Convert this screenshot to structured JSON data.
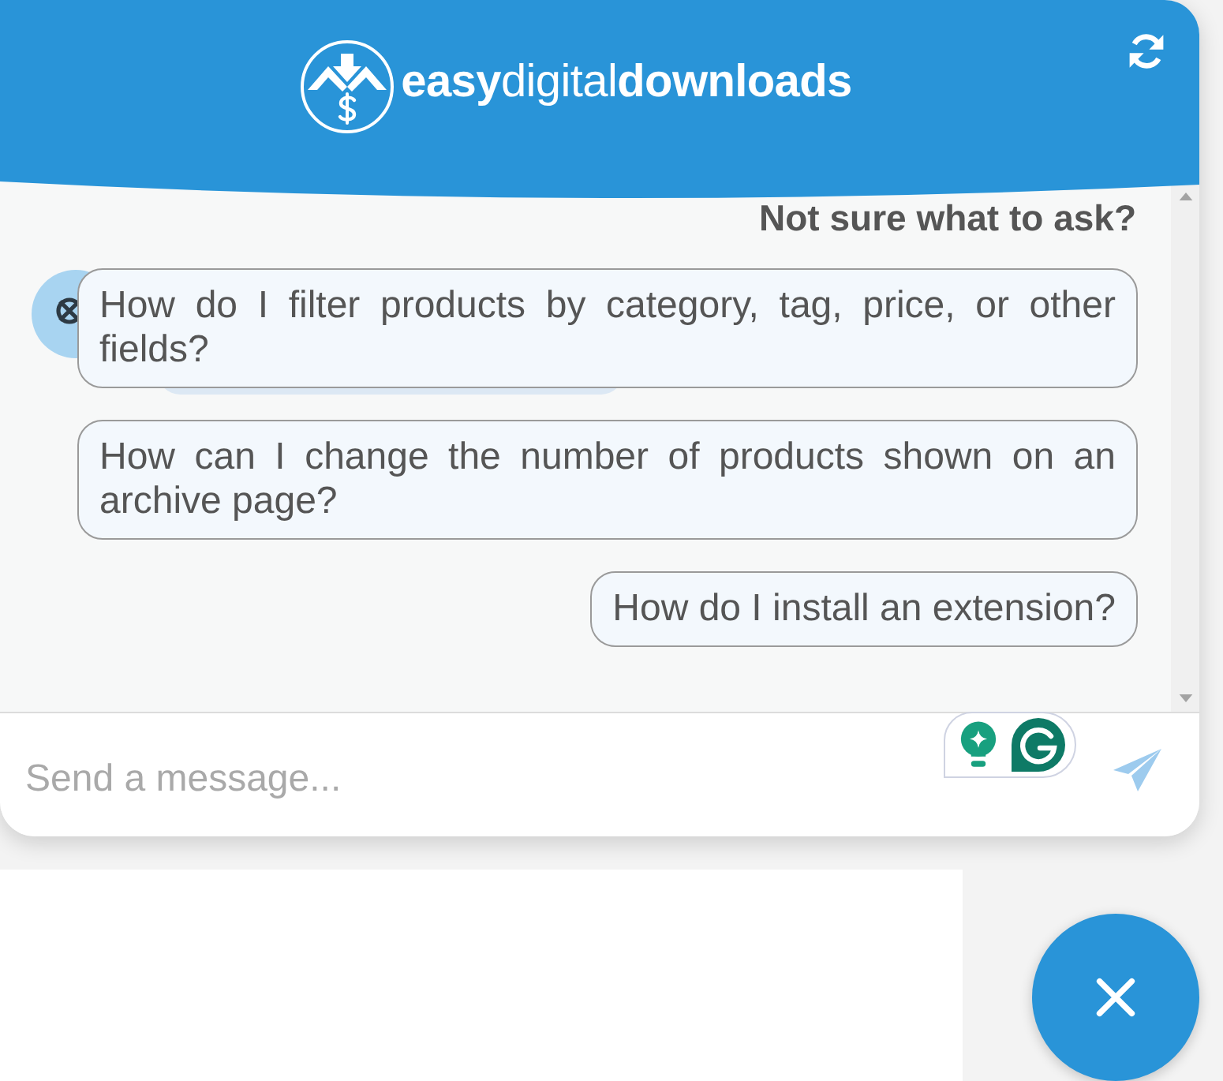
{
  "header": {
    "logo_text": "**easy**digital**downloads**"
  },
  "conversation": {
    "prompt": "Not sure what to ask?",
    "suggestions": [
      "How do I filter products by category, tag, price, or other fields?",
      "How can I change the number of products shown on an archive page?",
      "How do I install an extension?"
    ]
  },
  "composer": {
    "placeholder": "Send a message..."
  }
}
